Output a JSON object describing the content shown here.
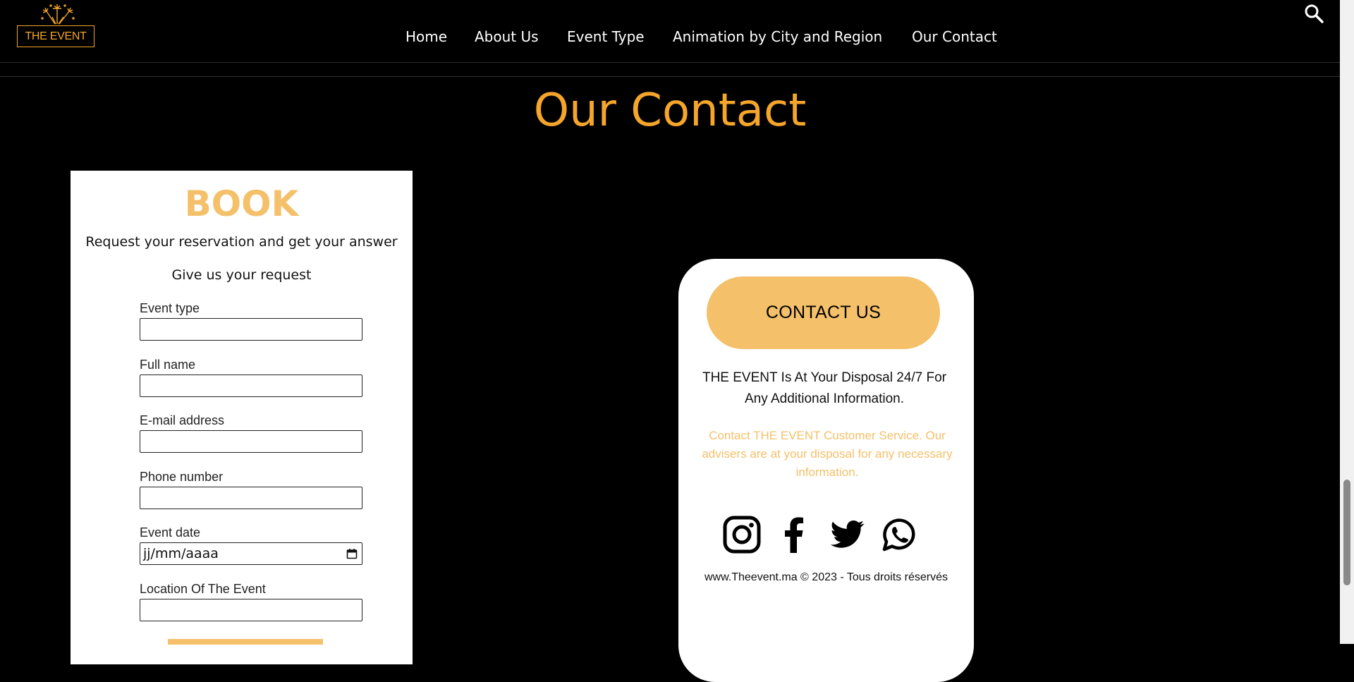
{
  "header": {
    "logo_text": "THE EVENT",
    "nav": [
      {
        "label": "Home"
      },
      {
        "label": "About Us"
      },
      {
        "label": "Event Type"
      },
      {
        "label": "Animation by City and Region"
      },
      {
        "label": "Our Contact"
      }
    ],
    "search_icon": "search-icon"
  },
  "page": {
    "title": "Our Contact"
  },
  "booking": {
    "title": "BOOK",
    "subtitle": "Request your reservation and get your answer",
    "prompt": "Give us your request",
    "fields": [
      {
        "label": "Event type",
        "value": ""
      },
      {
        "label": "Full name",
        "value": ""
      },
      {
        "label": "E-mail address",
        "value": ""
      },
      {
        "label": "Phone number",
        "value": ""
      },
      {
        "label": "Event date",
        "placeholder": "jj/mm/aaaa"
      },
      {
        "label": "Location Of The Event",
        "value": ""
      }
    ]
  },
  "contact": {
    "button_label": "CONTACT US",
    "info": "THE EVENT Is At Your Disposal 24/7 For Any Additional Information.",
    "description": "Contact THE EVENT Customer Service. Our advisers are at your disposal for any necessary information.",
    "social": [
      "instagram-icon",
      "facebook-icon",
      "twitter-icon",
      "whatsapp-icon"
    ],
    "copyright": "www.Theevent.ma © 2023 - Tous droits réservés"
  },
  "colors": {
    "accent": "#f4a52a",
    "accent_light": "#f4c06a",
    "background": "#000000",
    "card": "#ffffff"
  }
}
